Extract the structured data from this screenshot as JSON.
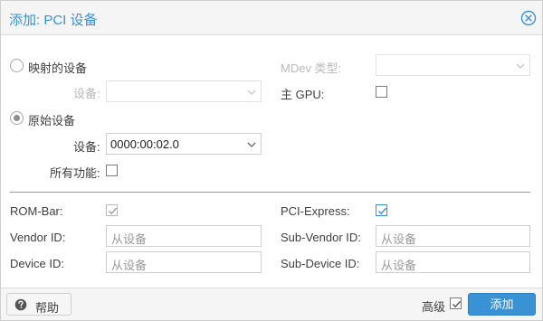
{
  "dialog": {
    "title": "添加: PCI 设备"
  },
  "mapping": {
    "mapped_device_label": "映射的设备",
    "device_label": "设备:",
    "mdev_type_label": "MDev 类型:",
    "primary_gpu_label": "主 GPU:",
    "raw_device_label": "原始设备",
    "raw_device_select_label": "设备:",
    "raw_device_value": "0000:00:02.0",
    "all_functions_label": "所有功能:"
  },
  "options": {
    "rombar_label": "ROM-Bar:",
    "pcie_label": "PCI-Express:",
    "vendor_id_label": "Vendor ID:",
    "vendor_id_placeholder": "从设备",
    "sub_vendor_id_label": "Sub-Vendor ID:",
    "sub_vendor_id_placeholder": "从设备",
    "device_id_label": "Device ID:",
    "device_id_placeholder": "从设备",
    "sub_device_id_label": "Sub-Device ID:",
    "sub_device_id_placeholder": "从设备"
  },
  "footer": {
    "help_label": "帮助",
    "advanced_label": "高级",
    "add_label": "添加"
  }
}
